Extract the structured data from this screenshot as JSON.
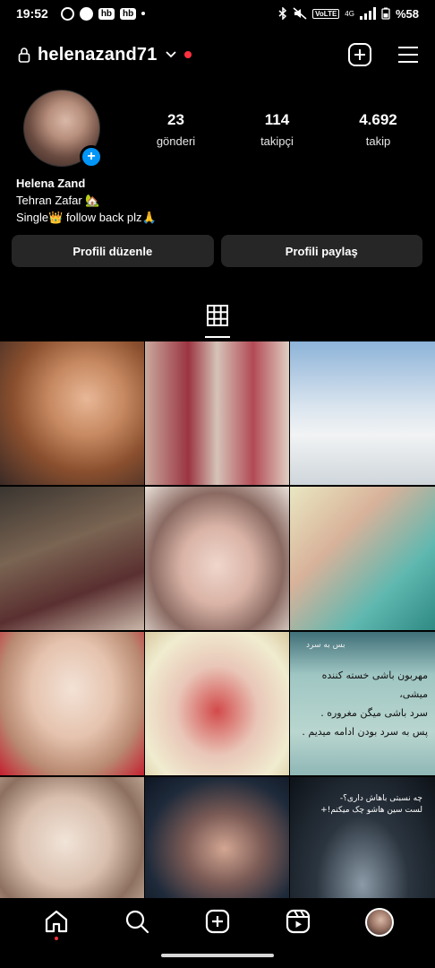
{
  "status_bar": {
    "time": "19:52",
    "badge_1": "hb",
    "badge_2": "hb",
    "network": "VoLTE",
    "network_sub": "4G",
    "battery": "%58"
  },
  "header": {
    "username": "helenazand71",
    "notification_color": "#ff3040"
  },
  "profile": {
    "stats": [
      {
        "value": "23",
        "label": "gönderi"
      },
      {
        "value": "114",
        "label": "takipçi"
      },
      {
        "value": "4.692",
        "label": "takip"
      }
    ],
    "name": "Helena Zand",
    "bio_line_1": "Tehran Zafar 🏡",
    "bio_line_2": "Single👑 follow back plz🙏",
    "add_story_glyph": "+"
  },
  "actions": {
    "edit_label": "Profili düzenle",
    "share_label": "Profili paylaş"
  },
  "posts": {
    "quote_title": "بس به سرد",
    "quote_lines": [
      "مهربون باشی خسته کننده میشی،",
      "سرد باشی میگن مغروره .",
      "پس به سرد بودن ادامه میدیم ."
    ],
    "poster_lines": [
      "چه نسبتی باهاش داری؟-",
      "لست سین هاشو چک میکنم!+"
    ]
  },
  "colors": {
    "accent": "#0095f6",
    "button_bg": "#262626",
    "background": "#000000"
  },
  "icons": {
    "header": [
      "lock-icon",
      "chevron-down-icon",
      "new-post-icon",
      "menu-icon"
    ],
    "nav": [
      "home-icon",
      "search-icon",
      "create-icon",
      "reels-icon",
      "profile-avatar"
    ]
  }
}
